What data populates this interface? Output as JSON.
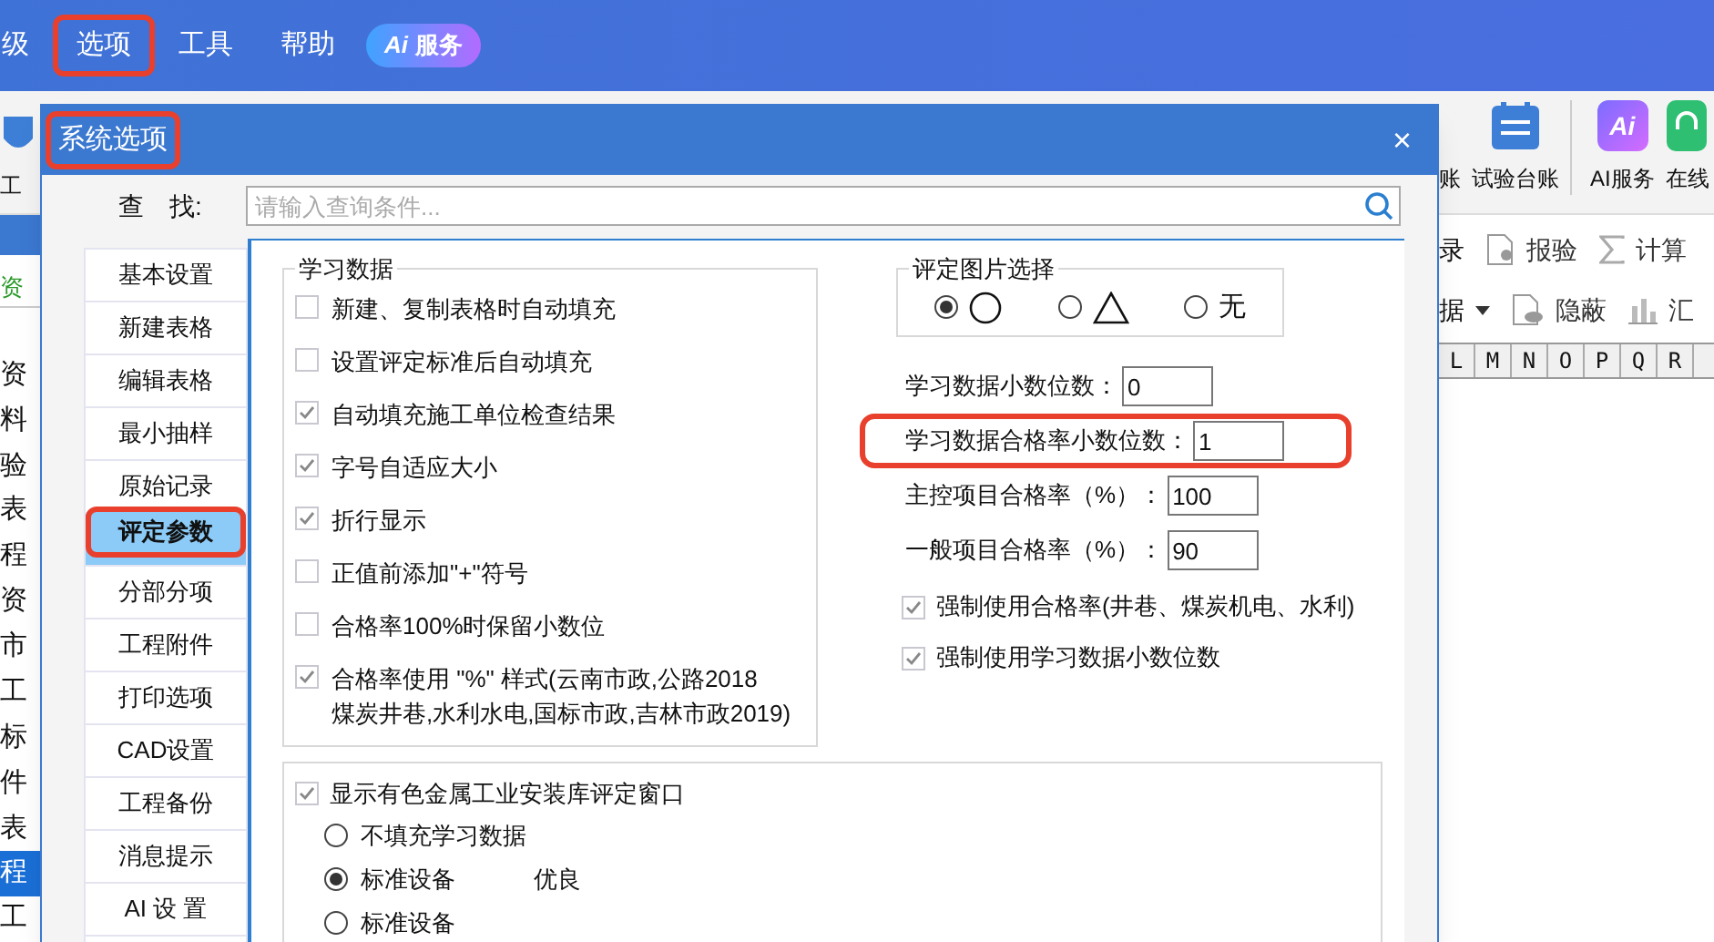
{
  "menu": [
    {
      "label": "级",
      "highlighted": false
    },
    {
      "label": "选项",
      "highlighted": true
    },
    {
      "label": "工具",
      "highlighted": false
    },
    {
      "label": "帮助",
      "highlighted": false
    }
  ],
  "ai_badge": {
    "icon": "Ai",
    "label": "服务"
  },
  "toolbar_left": {
    "label": "工"
  },
  "toolbar_right": [
    {
      "label": "账",
      "kind": "cut"
    },
    {
      "label": "试验台账",
      "kind": "ledger"
    },
    {
      "label": "AI服务",
      "kind": "ai",
      "icon": "Ai"
    },
    {
      "label": "在线",
      "kind": "online"
    }
  ],
  "left_list": {
    "header": "资",
    "items": [
      {
        "label": "资",
        "selected": false
      },
      {
        "label": "料",
        "selected": false
      },
      {
        "label": "验",
        "selected": false
      },
      {
        "label": "表",
        "selected": false
      },
      {
        "label": "程",
        "selected": false
      },
      {
        "label": "资",
        "selected": false
      },
      {
        "label": "市",
        "selected": false
      },
      {
        "label": "工",
        "selected": false
      },
      {
        "label": "标",
        "selected": false
      },
      {
        "label": "件",
        "selected": false
      },
      {
        "label": "表",
        "selected": false
      },
      {
        "label": "程",
        "selected": true
      },
      {
        "label": "工",
        "selected": false
      }
    ]
  },
  "ribbon_rows": [
    [
      {
        "label": "录",
        "kind": "plain"
      },
      {
        "label": "报验",
        "kind": "document"
      },
      {
        "label": "计算",
        "kind": "sigma"
      }
    ],
    [
      {
        "label": "据",
        "kind": "dropdown"
      },
      {
        "label": "隐蔽",
        "kind": "eye"
      },
      {
        "label": "汇",
        "kind": "bars"
      }
    ]
  ],
  "columns": [
    "L",
    "M",
    "N",
    "O",
    "P",
    "Q",
    "R"
  ],
  "dialog": {
    "title": "系统选项",
    "title_highlighted": true,
    "close": "×",
    "search": {
      "label": "查　找:",
      "placeholder": "请输入查询条件..."
    },
    "nav": [
      {
        "label": "基本设置",
        "selected": false,
        "highlighted": false
      },
      {
        "label": "新建表格",
        "selected": false,
        "highlighted": false
      },
      {
        "label": "编辑表格",
        "selected": false,
        "highlighted": false
      },
      {
        "label": "最小抽样",
        "selected": false,
        "highlighted": false
      },
      {
        "label": "原始记录",
        "selected": false,
        "highlighted": false
      },
      {
        "label": "评定参数",
        "selected": true,
        "highlighted": true
      },
      {
        "label": "分部分项",
        "selected": false,
        "highlighted": false
      },
      {
        "label": "工程附件",
        "selected": false,
        "highlighted": false
      },
      {
        "label": "打印选项",
        "selected": false,
        "highlighted": false
      },
      {
        "label": "CAD设置",
        "selected": false,
        "highlighted": false
      },
      {
        "label": "工程备份",
        "selected": false,
        "highlighted": false
      },
      {
        "label": "消息提示",
        "selected": false,
        "highlighted": false
      },
      {
        "label": "AI 设 置",
        "selected": false,
        "highlighted": false
      }
    ],
    "learning_group": {
      "title": "学习数据",
      "options": [
        {
          "label": "新建、复制表格时自动填充",
          "checked": false
        },
        {
          "label": "设置评定标准后自动填充",
          "checked": false
        },
        {
          "label": "自动填充施工单位检查结果",
          "checked": true
        },
        {
          "label": "字号自适应大小",
          "checked": true
        },
        {
          "label": "折行显示",
          "checked": true
        },
        {
          "label": "正值前添加\"+\"符号",
          "checked": false
        },
        {
          "label": "合格率100%时保留小数位",
          "checked": false
        },
        {
          "label": "合格率使用 \"%\" 样式(云南市政,公路2018\n煤炭井巷,水利水电,国标市政,吉林市政2019)",
          "checked": true
        }
      ]
    },
    "image_group": {
      "title": "评定图片选择",
      "options": [
        {
          "kind": "circle",
          "selected": true
        },
        {
          "kind": "triangle",
          "selected": false
        },
        {
          "kind": "text",
          "label": "无",
          "selected": false
        }
      ]
    },
    "fields": [
      {
        "label": "学习数据小数位数：",
        "value": "0",
        "highlighted": false
      },
      {
        "label": "学习数据合格率小数位数：",
        "value": "1",
        "highlighted": true
      },
      {
        "label": "主控项目合格率（%）：",
        "value": "100",
        "highlighted": false
      },
      {
        "label": "一般项目合格率（%）：",
        "value": "90",
        "highlighted": false
      }
    ],
    "force_options": [
      {
        "label": "强制使用合格率(井巷、煤炭机电、水利)",
        "checked": true
      },
      {
        "label": "强制使用学习数据小数位数",
        "checked": true
      }
    ],
    "nonferrous": {
      "label": "显示有色金属工业安装库评定窗口",
      "checked": true,
      "options": [
        {
          "label": "不填充学习数据",
          "selected": false
        },
        {
          "label": "标准设备",
          "grade": "优良",
          "selected": true
        },
        {
          "label": "标准设备",
          "selected": false
        }
      ]
    }
  }
}
